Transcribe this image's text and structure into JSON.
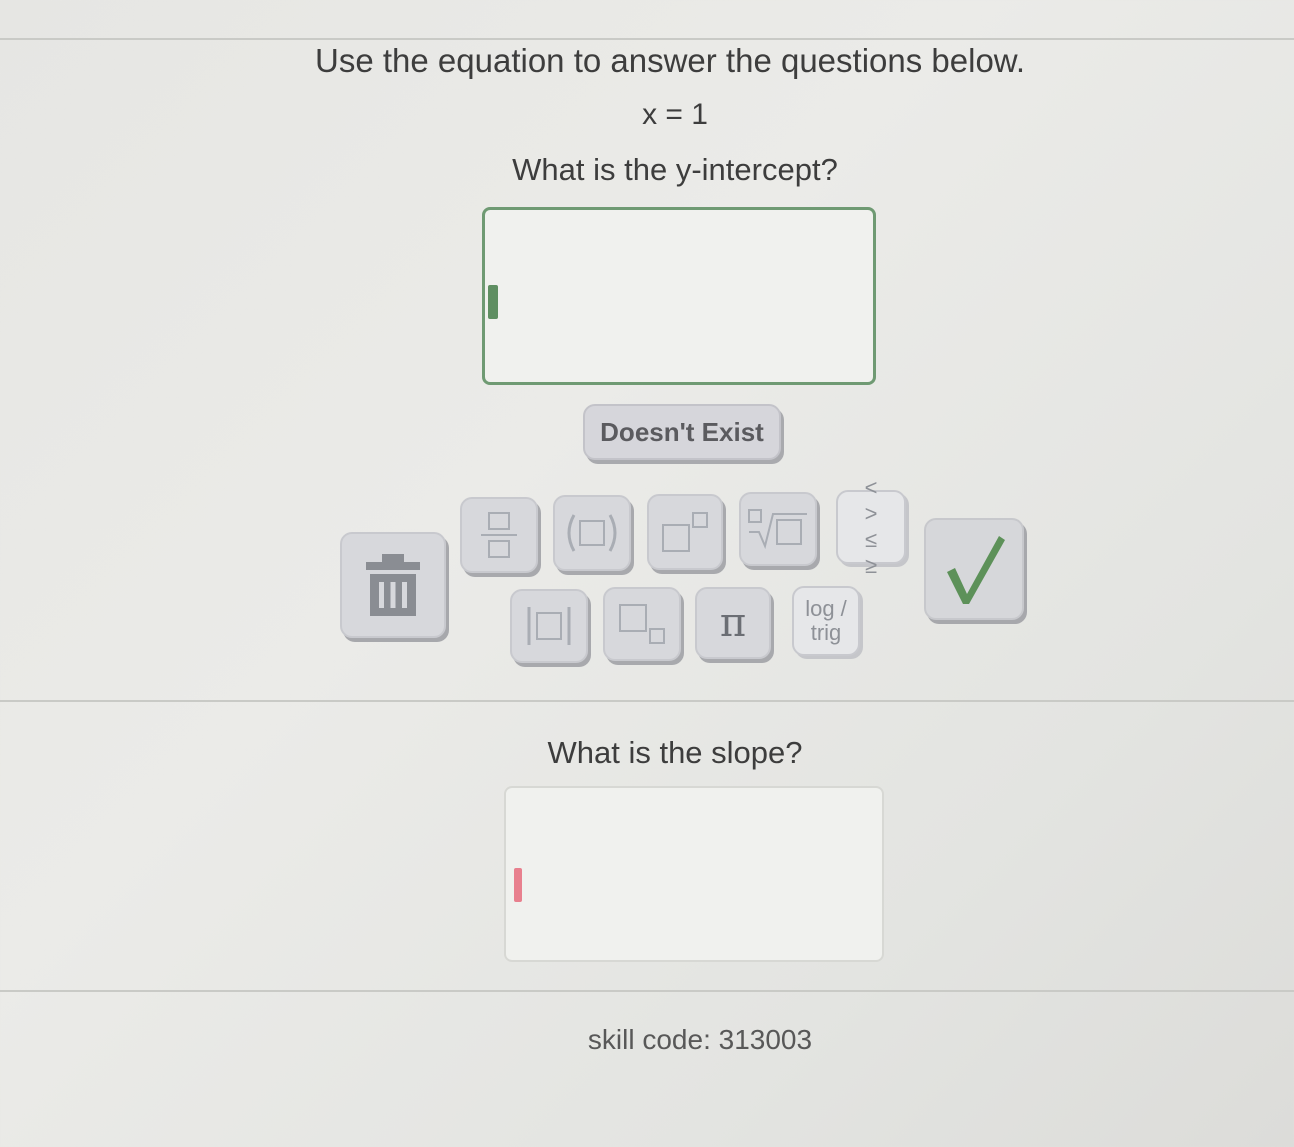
{
  "instructions": "Use the equation to answer the questions below.",
  "equation": "x = 1",
  "question1": {
    "prompt": "What is the y-intercept?",
    "answer_value": "",
    "doesnt_exist_label": "Doesn't Exist"
  },
  "keypad": {
    "keys": [
      {
        "icon": "fraction-icon"
      },
      {
        "icon": "parentheses-icon"
      },
      {
        "icon": "exponent-icon"
      },
      {
        "icon": "nth-root-icon"
      },
      {
        "icon": "inequality-icon",
        "row1": "< >",
        "row2": "≤ ≥"
      },
      {
        "icon": "absolute-value-icon"
      },
      {
        "icon": "subscript-icon"
      },
      {
        "icon": "pi-icon",
        "glyph": "π"
      },
      {
        "icon": "log-trig-icon",
        "line1": "log /",
        "line2": "trig"
      }
    ],
    "delete_icon": "trash-icon",
    "submit_icon": "checkmark-icon"
  },
  "question2": {
    "prompt": "What is the slope?",
    "answer_value": ""
  },
  "skill_code": "skill code: 313003",
  "colors": {
    "active_border": "#6f9a73",
    "active_cursor": "#5f8f62",
    "inactive_cursor": "#e8808e",
    "check": "#5d9159"
  }
}
